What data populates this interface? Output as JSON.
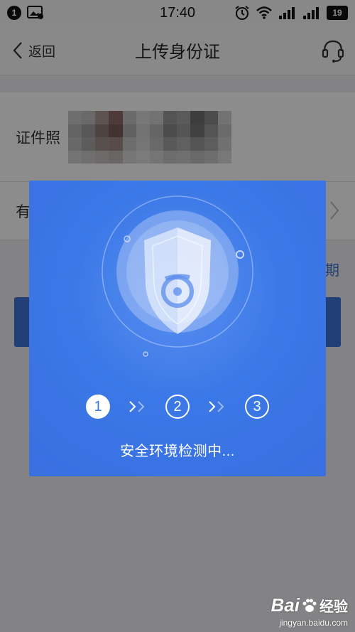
{
  "statusbar": {
    "notif_badge": "1",
    "time": "17:40",
    "sim2_label": "2",
    "battery": "19"
  },
  "navbar": {
    "back_label": "返回",
    "title": "上传身份证"
  },
  "form": {
    "id_photo_label": "证件照",
    "valid_label_partial": "有",
    "side_text_partial": "期"
  },
  "dialog": {
    "steps": [
      "1",
      "2",
      "3"
    ],
    "active_step": 1,
    "status_text": "安全环境检测中..."
  },
  "watermark": {
    "logo_text": "Bai",
    "logo_suffix": "经验",
    "url": "jingyan.baidu.com"
  },
  "colors": {
    "dialog_blue": "#3b78e7",
    "accent_blue": "#3c74d8"
  }
}
